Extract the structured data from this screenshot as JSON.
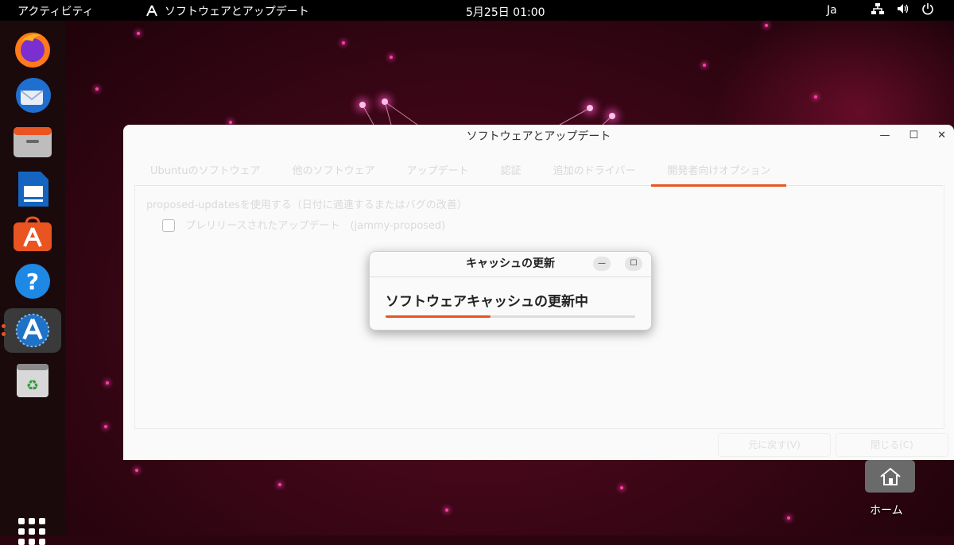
{
  "topbar": {
    "activities": "アクティビティ",
    "app_name": "ソフトウェアとアップデート",
    "clock": "5月25日  01:00",
    "input_method": "Ja",
    "tray_icons": [
      "network-icon",
      "volume-icon",
      "power-icon"
    ]
  },
  "dock": {
    "items": [
      "firefox-icon",
      "thunderbird-icon",
      "files-icon",
      "libreoffice-writer-icon",
      "app-center-icon",
      "help-icon",
      "software-updater-icon",
      "trash-icon"
    ],
    "active": "software-updater-icon",
    "show_apps": "show-apps-grid-icon"
  },
  "main_window": {
    "title": "ソフトウェアとアップデート",
    "tabs": [
      "Ubuntuのソフトウェア",
      "他のソフトウェア",
      "アップデート",
      "認証",
      "追加のドライバー",
      "開発者向けオプション"
    ],
    "selected_tab": 5,
    "option_line": "proposed-updatesを使用する（日付に適連するまたはバグの改善）",
    "checkbox_label": "プレリリースされたアップデート",
    "checkbox_suffix": "(jammy-proposed)",
    "button_revert": "元に戻す(V)",
    "button_close": "閉じる(C)"
  },
  "dialog": {
    "title": "キャッシュの更新",
    "message": "ソフトウェアキャッシュの更新中",
    "progress": 0.42
  },
  "desktop": {
    "home_label": "ホーム"
  },
  "colors": {
    "accent": "#e95420",
    "topbar": "#000000",
    "dock": "#1a0a0c"
  }
}
